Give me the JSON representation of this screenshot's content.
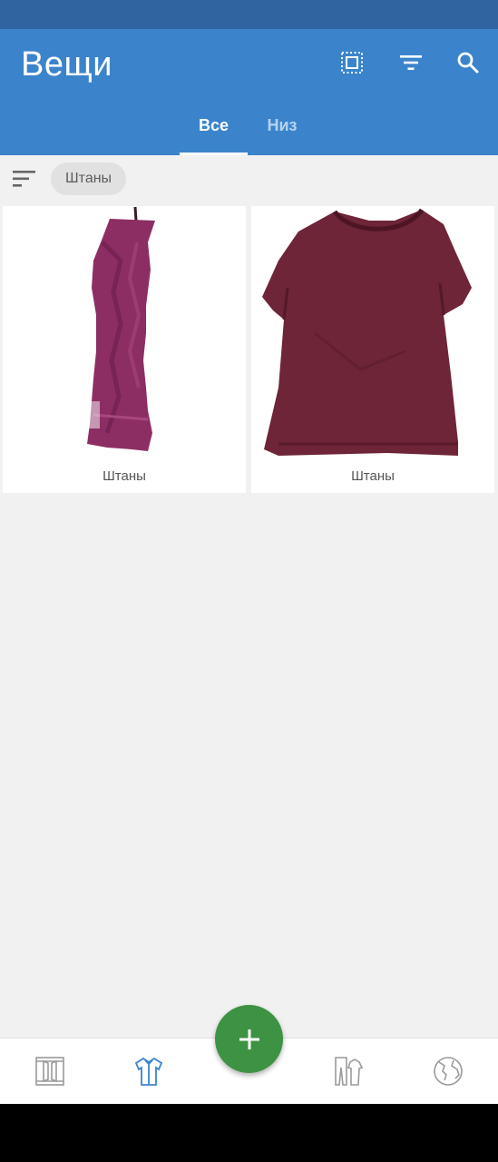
{
  "app_bar": {
    "title": "Вещи",
    "icons": [
      "select-all-icon",
      "filter-icon",
      "search-icon"
    ],
    "color": "#3b84cc"
  },
  "tabs": [
    {
      "label": "Все",
      "active": true
    },
    {
      "label": "Низ",
      "active": false
    }
  ],
  "filter": {
    "sort_icon": "sort-icon",
    "chip_label": "Штаны"
  },
  "items": [
    {
      "caption": "Штаны",
      "image": "pants-photo"
    },
    {
      "caption": "Штаны",
      "image": "tshirt-photo"
    }
  ],
  "fab": {
    "icon": "plus-icon",
    "color": "#3e9243"
  },
  "bottom_nav": {
    "items": [
      {
        "icon": "wardrobe-icon",
        "active": false
      },
      {
        "icon": "shirt-icon",
        "active": true
      },
      {
        "icon": "outfits-icon",
        "active": false
      },
      {
        "icon": "globe-icon",
        "active": false
      }
    ],
    "active_color": "#3b84cc"
  }
}
